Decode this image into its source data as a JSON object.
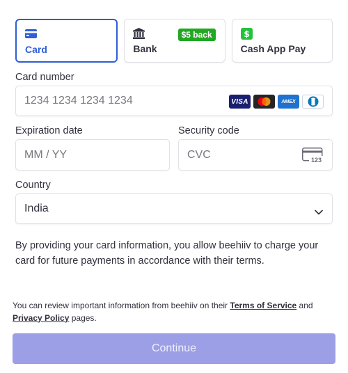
{
  "tabs": [
    {
      "label": "Card",
      "icon": "credit-card-icon",
      "selected": true
    },
    {
      "label": "Bank",
      "icon": "bank-icon",
      "badge": "$5 back"
    },
    {
      "label": "Cash App Pay",
      "icon": "cash-app-icon"
    }
  ],
  "card_number": {
    "label": "Card number",
    "placeholder": "1234 1234 1234 1234",
    "brands": [
      "VISA",
      "mastercard",
      "AMEX",
      "diners"
    ]
  },
  "expiry": {
    "label": "Expiration date",
    "placeholder": "MM / YY"
  },
  "cvc": {
    "label": "Security code",
    "placeholder": "CVC",
    "icon_text": "123"
  },
  "country": {
    "label": "Country",
    "value": "India"
  },
  "consent_text": "By providing your card information, you allow beehiiv to charge your card for future payments in accordance with their terms.",
  "terms": {
    "prefix": "You can review important information from beehiiv on their ",
    "tos": "Terms of Service",
    "and": " and",
    "privacy": "Privacy Policy",
    "suffix": " pages."
  },
  "continue_label": "Continue",
  "colors": {
    "accent": "#2f5fd6",
    "badge": "#22a722",
    "button": "#9c9ee6"
  }
}
